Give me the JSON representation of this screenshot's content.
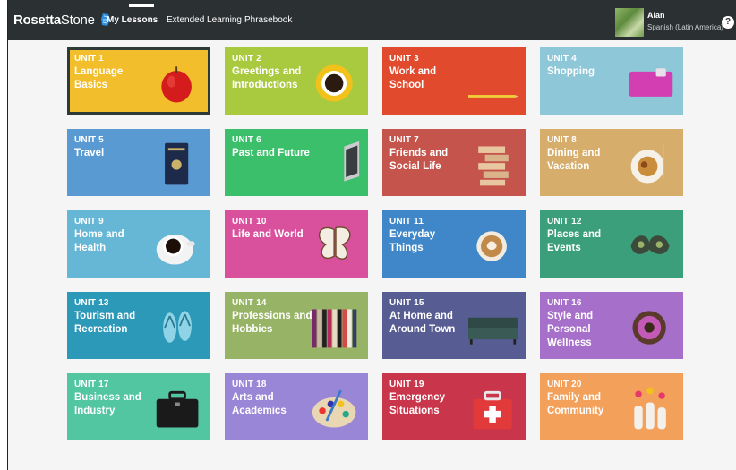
{
  "app": {
    "brand_bold": "Rosetta",
    "brand_light": "Stone",
    "nav": [
      "My Lessons",
      "Extended Learning",
      "Phrasebook"
    ],
    "user_name": "Alan",
    "user_language": "Spanish (Latin America)",
    "help_label": "?"
  },
  "units": [
    {
      "unit": "UNIT 1",
      "title": "Language Basics",
      "color": "#f2be2c",
      "icon": "apple-icon"
    },
    {
      "unit": "UNIT 2",
      "title": "Greetings and Introductions",
      "color": "#a9c93f",
      "icon": "coffee-cup-icon"
    },
    {
      "unit": "UNIT 3",
      "title": "Work and School",
      "color": "#e24a2d",
      "icon": "pencil-icon"
    },
    {
      "unit": "UNIT 4",
      "title": "Shopping",
      "color": "#8ec7d8",
      "icon": "wallet-icon"
    },
    {
      "unit": "UNIT 5",
      "title": "Travel",
      "color": "#5a9ad2",
      "icon": "passport-icon"
    },
    {
      "unit": "UNIT 6",
      "title": "Past and Future",
      "color": "#3bbf6a",
      "icon": "laptop-icon"
    },
    {
      "unit": "UNIT 7",
      "title": "Friends and Social Life",
      "color": "#c5544c",
      "icon": "jenga-blocks-icon"
    },
    {
      "unit": "UNIT 8",
      "title": "Dining and Vacation",
      "color": "#d6ad6a",
      "icon": "pasta-plate-icon"
    },
    {
      "unit": "UNIT 9",
      "title": "Home and Health",
      "color": "#66b7d6",
      "icon": "coffee-mug-icon"
    },
    {
      "unit": "UNIT 10",
      "title": "Life and World",
      "color": "#d9509d",
      "icon": "butterfly-icon"
    },
    {
      "unit": "UNIT 11",
      "title": "Everyday Things",
      "color": "#3f87c8",
      "icon": "latte-icon"
    },
    {
      "unit": "UNIT 12",
      "title": "Places and Events",
      "color": "#3a9f7a",
      "icon": "mask-icon"
    },
    {
      "unit": "UNIT 13",
      "title": "Tourism and Recreation",
      "color": "#2d99b8",
      "icon": "flip-flops-icon"
    },
    {
      "unit": "UNIT 14",
      "title": "Professions and Hobbies",
      "color": "#97b365",
      "icon": "colored-pencils-icon"
    },
    {
      "unit": "UNIT 15",
      "title": "At Home and Around Town",
      "color": "#575d93",
      "icon": "sofa-icon"
    },
    {
      "unit": "UNIT 16",
      "title": "Style and Personal Wellness",
      "color": "#a66fc9",
      "icon": "flower-icon"
    },
    {
      "unit": "UNIT 17",
      "title": "Business and Industry",
      "color": "#52c5a1",
      "icon": "briefcase-icon"
    },
    {
      "unit": "UNIT 18",
      "title": "Arts and Academics",
      "color": "#9a86d6",
      "icon": "paint-palette-icon"
    },
    {
      "unit": "UNIT 19",
      "title": "Emergency Situations",
      "color": "#c9364b",
      "icon": "first-aid-kit-icon"
    },
    {
      "unit": "UNIT 20",
      "title": "Family and Community",
      "color": "#f3a05a",
      "icon": "flower-vases-icon"
    }
  ],
  "selected_unit": "UNIT 1"
}
